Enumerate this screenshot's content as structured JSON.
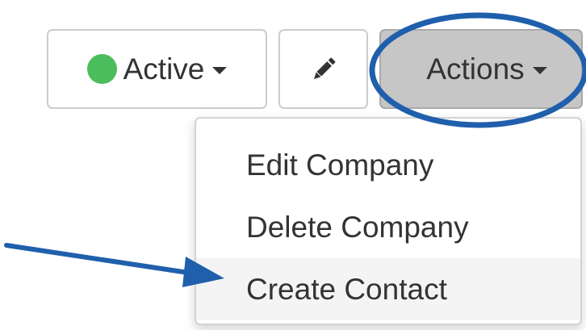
{
  "toolbar": {
    "status_label": "Active",
    "status_color": "#4cbd5c",
    "edit_icon": "pencil-icon",
    "actions_label": "Actions"
  },
  "actions_menu": {
    "items": [
      {
        "label": "Edit Company"
      },
      {
        "label": "Delete Company"
      },
      {
        "label": "Create Contact"
      }
    ],
    "hovered_item": "Create Contact"
  },
  "annotations": {
    "color": "#1f5fac",
    "circle_target": "actions-button",
    "arrow_target": "Create Contact"
  }
}
